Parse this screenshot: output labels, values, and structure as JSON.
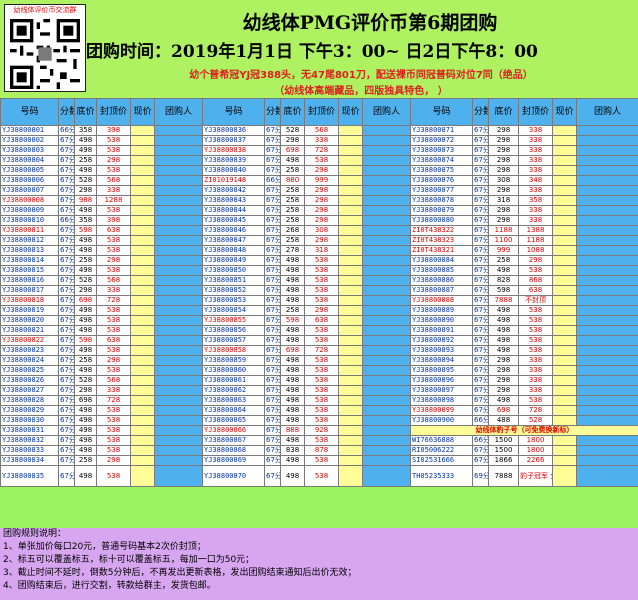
{
  "qr_label": "幼线体评价币交流群",
  "title": "幼线体PMG评价币第6期团购",
  "subtitle": "团购时间：2019年1月1日  下午3：00~ 日2日下午8：00",
  "note1": "幼个普希冠YJ冠388头，无47尾801刀，配送裸币同冠普码对位7同（绝品）",
  "note2": "（幼线体高端藏品，四版独具特色，  ）",
  "headers": [
    "号码",
    "分数",
    "底价",
    "封顶价",
    "现价",
    "团购人"
  ],
  "rows": [
    {
      "a": [
        "YJ38800801",
        "66分",
        "358",
        "398"
      ],
      "b": [
        "YJ38800836",
        "67分",
        "528",
        "568"
      ],
      "c": [
        "YJ38800871",
        "67分",
        "298",
        "338"
      ]
    },
    {
      "a": [
        "YJ38800802",
        "67分",
        "498",
        "538"
      ],
      "b": [
        "YJ38800837",
        "67分",
        "298",
        "338"
      ],
      "c": [
        "YJ38800872",
        "67分",
        "298",
        "338"
      ]
    },
    {
      "a": [
        "YJ38800803",
        "67分",
        "498",
        "538"
      ],
      "b": [
        "YJ38800838",
        "67分",
        "698",
        "728"
      ],
      "c": [
        "YJ38800873",
        "67分",
        "298",
        "338"
      ]
    },
    {
      "a": [
        "YJ38800804",
        "67分",
        "258",
        "298"
      ],
      "b": [
        "YJ38800839",
        "67分",
        "498",
        "538"
      ],
      "c": [
        "YJ38800874",
        "67分",
        "298",
        "338"
      ]
    },
    {
      "a": [
        "YJ38800805",
        "67分",
        "498",
        "538"
      ],
      "b": [
        "YJ38800840",
        "67分",
        "258",
        "298"
      ],
      "c": [
        "YJ38800875",
        "67分",
        "298",
        "338"
      ]
    },
    {
      "a": [
        "YJ38800806",
        "67分",
        "528",
        "568"
      ],
      "b": [
        "ZI01019148",
        "66分",
        "880",
        "999"
      ],
      "c": [
        "YJ38800876",
        "67分",
        "308",
        "348"
      ]
    },
    {
      "a": [
        "YJ38800807",
        "67分",
        "298",
        "338"
      ],
      "b": [
        "YJ38800842",
        "67分",
        "258",
        "298"
      ],
      "c": [
        "YJ38800877",
        "67分",
        "298",
        "338"
      ]
    },
    {
      "a": [
        "YJ38800808",
        "67分",
        "988",
        "1288"
      ],
      "b": [
        "YJ38800843",
        "67分",
        "258",
        "298"
      ],
      "c": [
        "YJ38800878",
        "67分",
        "318",
        "358"
      ]
    },
    {
      "a": [
        "YJ38800809",
        "67分",
        "498",
        "538"
      ],
      "b": [
        "YJ38800844",
        "67分",
        "258",
        "298"
      ],
      "c": [
        "YJ38800879",
        "67分",
        "298",
        "338"
      ]
    },
    {
      "a": [
        "YJ38800810",
        "66分",
        "358",
        "398"
      ],
      "b": [
        "YJ38800845",
        "67分",
        "258",
        "298"
      ],
      "c": [
        "YJ38800880",
        "67分",
        "298",
        "338"
      ]
    },
    {
      "a": [
        "YJ38800811",
        "67分",
        "598",
        "638"
      ],
      "b": [
        "YJ38800846",
        "67分",
        "268",
        "308"
      ],
      "c": [
        "ZI0T438322",
        "67分",
        "1188",
        "1388"
      ]
    },
    {
      "a": [
        "YJ38800812",
        "67分",
        "498",
        "538"
      ],
      "b": [
        "YJ38800847",
        "67分",
        "258",
        "298"
      ],
      "c": [
        "ZI0T438323",
        "67分",
        "1100",
        "1188"
      ]
    },
    {
      "a": [
        "YJ38800813",
        "67分",
        "498",
        "538"
      ],
      "b": [
        "YJ38800848",
        "67分",
        "278",
        "318"
      ],
      "c": [
        "ZI0T438321",
        "67分",
        "999",
        "1088"
      ]
    },
    {
      "a": [
        "YJ38800814",
        "67分",
        "258",
        "298"
      ],
      "b": [
        "YJ38800849",
        "67分",
        "498",
        "538"
      ],
      "c": [
        "YJ38800884",
        "67分",
        "258",
        "298"
      ]
    },
    {
      "a": [
        "YJ38800815",
        "67分",
        "498",
        "538"
      ],
      "b": [
        "YJ38800850",
        "67分",
        "498",
        "538"
      ],
      "c": [
        "YJ38800885",
        "67分",
        "498",
        "538"
      ]
    },
    {
      "a": [
        "YJ38800816",
        "67分",
        "528",
        "568"
      ],
      "b": [
        "YJ38800851",
        "67分",
        "498",
        "538"
      ],
      "c": [
        "YJ38800886",
        "67分",
        "828",
        "868"
      ]
    },
    {
      "a": [
        "YJ38800817",
        "67分",
        "298",
        "338"
      ],
      "b": [
        "YJ38800852",
        "67分",
        "498",
        "538"
      ],
      "c": [
        "YJ38800887",
        "67分",
        "598",
        "638"
      ]
    },
    {
      "a": [
        "YJ38800818",
        "67分",
        "698",
        "728"
      ],
      "b": [
        "YJ38800853",
        "67分",
        "498",
        "538"
      ],
      "c": [
        "YJ38800888",
        "67分",
        "7888",
        "不封顶"
      ]
    },
    {
      "a": [
        "YJ38800819",
        "67分",
        "498",
        "538"
      ],
      "b": [
        "YJ38800854",
        "67分",
        "258",
        "298"
      ],
      "c": [
        "YJ38800889",
        "67分",
        "498",
        "538"
      ]
    },
    {
      "a": [
        "YJ38800820",
        "67分",
        "498",
        "538"
      ],
      "b": [
        "YJ38800855",
        "67分",
        "598",
        "638"
      ],
      "c": [
        "YJ38800890",
        "67分",
        "498",
        "538"
      ]
    },
    {
      "a": [
        "YJ38800821",
        "67分",
        "498",
        "538"
      ],
      "b": [
        "YJ38800856",
        "67分",
        "498",
        "538"
      ],
      "c": [
        "YJ38800891",
        "67分",
        "498",
        "538"
      ]
    },
    {
      "a": [
        "YJ38800822",
        "67分",
        "598",
        "638"
      ],
      "b": [
        "YJ38800857",
        "67分",
        "498",
        "538"
      ],
      "c": [
        "YJ38800892",
        "67分",
        "498",
        "538"
      ]
    },
    {
      "a": [
        "YJ38800823",
        "67分",
        "498",
        "538"
      ],
      "b": [
        "YJ38800858",
        "67分",
        "698",
        "728"
      ],
      "c": [
        "YJ38800893",
        "67分",
        "498",
        "538"
      ]
    },
    {
      "a": [
        "YJ38800824",
        "67分",
        "258",
        "298"
      ],
      "b": [
        "YJ38800859",
        "67分",
        "498",
        "538"
      ],
      "c": [
        "YJ38800894",
        "67分",
        "298",
        "338"
      ]
    },
    {
      "a": [
        "YJ38800825",
        "67分",
        "498",
        "538"
      ],
      "b": [
        "YJ38800860",
        "67分",
        "498",
        "538"
      ],
      "c": [
        "YJ38800895",
        "67分",
        "298",
        "338"
      ]
    },
    {
      "a": [
        "YJ38800826",
        "67分",
        "528",
        "568"
      ],
      "b": [
        "YJ38800861",
        "67分",
        "498",
        "538"
      ],
      "c": [
        "YJ38800896",
        "67分",
        "298",
        "338"
      ]
    },
    {
      "a": [
        "YJ38800827",
        "67分",
        "298",
        "338"
      ],
      "b": [
        "YJ38800862",
        "67分",
        "498",
        "538"
      ],
      "c": [
        "YJ38800897",
        "67分",
        "298",
        "338"
      ]
    },
    {
      "a": [
        "YJ38800828",
        "67分",
        "698",
        "728"
      ],
      "b": [
        "YJ38800863",
        "67分",
        "498",
        "538"
      ],
      "c": [
        "YJ38800898",
        "67分",
        "498",
        "538"
      ]
    },
    {
      "a": [
        "YJ38800829",
        "67分",
        "498",
        "538"
      ],
      "b": [
        "YJ38800864",
        "67分",
        "498",
        "538"
      ],
      "c": [
        "YJ38800899",
        "67分",
        "698",
        "728"
      ]
    },
    {
      "a": [
        "YJ38800830",
        "67分",
        "498",
        "538"
      ],
      "b": [
        "YJ38800865",
        "67分",
        "498",
        "538"
      ],
      "c": [
        "YJ38800900",
        "66分",
        "488",
        "528"
      ]
    },
    {
      "a": [
        "YJ38800831",
        "67分",
        "498",
        "538"
      ],
      "b": [
        "YJ38800866",
        "67分",
        "888",
        "928"
      ],
      "special": "幼线体豹子号（可免费换新标）"
    },
    {
      "a": [
        "YJ38800832",
        "67分",
        "498",
        "538"
      ],
      "b": [
        "YJ38800867",
        "67分",
        "498",
        "538"
      ],
      "c": [
        "WI76636888",
        "66分",
        "1500",
        "1800"
      ]
    },
    {
      "a": [
        "YJ38800833",
        "67分",
        "498",
        "538"
      ],
      "b": [
        "YJ38800868",
        "67分",
        "838",
        "878"
      ],
      "c": [
        "RI05006222",
        "67分",
        "1500",
        "1800"
      ]
    },
    {
      "a": [
        "YJ38800834",
        "67分",
        "258",
        "298"
      ],
      "b": [
        "YJ38800869",
        "67分",
        "498",
        "538"
      ],
      "c": [
        "SI02531666",
        "67分",
        "1866",
        "2266"
      ]
    },
    {
      "a": [
        "YJ38800835",
        "67分",
        "498",
        "538"
      ],
      "b": [
        "YJ38800870",
        "67分",
        "498",
        "538"
      ],
      "c": [
        "TH05235333",
        "69分",
        "7888",
        "豹子冠军 分不封顶"
      ]
    }
  ],
  "rules_title": "团购规则说明：",
  "rules": [
    "1、单张加价每口20元，普通号码基本2次价封顶；",
    "2、标五可以覆盖标五，标十可以覆盖标五，每加一口为50元；",
    "3、截止时间不延时，倒数5分钟后，不再发出更新表格，发出团购结束通知后出价无效；",
    "4、团购结束后，进行交割，转款给群主，发货包邮。"
  ],
  "colors": {
    "green": "#9cf25e",
    "blue": "#4fb0ee",
    "yellow": "#fffb96",
    "red": "#e00000",
    "purple": "#d8a6f0"
  }
}
